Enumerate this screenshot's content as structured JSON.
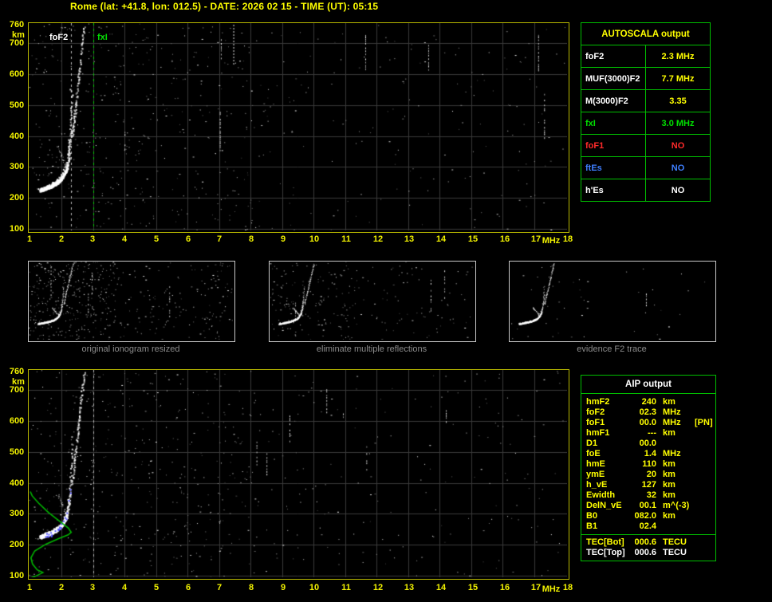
{
  "title": "Rome (lat: +41.8, lon: 012.5) - DATE: 2026 02 15 - TIME (UT): 05:15",
  "axes": {
    "x_ticks": [
      "1",
      "2",
      "3",
      "4",
      "5",
      "6",
      "7",
      "8",
      "9",
      "10",
      "11",
      "12",
      "13",
      "14",
      "15",
      "16",
      "17",
      "18"
    ],
    "x_unit": "MHz",
    "y_ticks": [
      "760",
      "700",
      "600",
      "500",
      "400",
      "300",
      "200",
      "100"
    ],
    "y_unit": "km"
  },
  "top_plot": {
    "fof2_label": "foF2",
    "fxi_label": "fxI",
    "fof2_mhz": 2.3,
    "fxi_mhz": 3.0
  },
  "autoscala_table": {
    "title": "AUTOSCALA output",
    "rows": [
      {
        "label": "foF2",
        "value": "2.3 MHz",
        "label_color": "#ffffff",
        "value_color": "#ffff00"
      },
      {
        "label": "MUF(3000)F2",
        "value": "7.7 MHz",
        "label_color": "#ffffff",
        "value_color": "#ffff00"
      },
      {
        "label": "M(3000)F2",
        "value": "3.35",
        "label_color": "#ffffff",
        "value_color": "#ffff00"
      },
      {
        "label": "fxI",
        "value": "3.0 MHz",
        "label_color": "#00e000",
        "value_color": "#00e000"
      },
      {
        "label": "foF1",
        "value": "NO",
        "label_color": "#ff2a2a",
        "value_color": "#ff2a2a"
      },
      {
        "label": "ftEs",
        "value": "NO",
        "label_color": "#3f7fff",
        "value_color": "#3f7fff"
      },
      {
        "label": "h'Es",
        "value": "NO",
        "label_color": "#ffffff",
        "value_color": "#ffffff"
      }
    ]
  },
  "thumbnails": [
    {
      "caption": "original ionogram resized"
    },
    {
      "caption": "eliminate multiple reflections"
    },
    {
      "caption": "evidence F2 trace"
    }
  ],
  "aip_table": {
    "title": "AIP output",
    "rows": [
      {
        "label": "hmF2",
        "value": "240",
        "unit": "km",
        "extra": ""
      },
      {
        "label": "foF2",
        "value": "02.3",
        "unit": "MHz",
        "extra": ""
      },
      {
        "label": "foF1",
        "value": "00.0",
        "unit": "MHz",
        "extra": "[PN]"
      },
      {
        "label": "hmF1",
        "value": "---",
        "unit": "km",
        "extra": ""
      },
      {
        "label": "D1",
        "value": "00.0",
        "unit": "",
        "extra": ""
      },
      {
        "label": "foE",
        "value": "1.4",
        "unit": "MHz",
        "extra": ""
      },
      {
        "label": "hmE",
        "value": "110",
        "unit": "km",
        "extra": ""
      },
      {
        "label": "ymE",
        "value": "20",
        "unit": "km",
        "extra": ""
      },
      {
        "label": "h_vE",
        "value": "127",
        "unit": "km",
        "extra": ""
      },
      {
        "label": "Ewidth",
        "value": "32",
        "unit": "km",
        "extra": ""
      },
      {
        "label": "DelN_vE",
        "value": "00.1",
        "unit": "m^(-3)",
        "extra": ""
      },
      {
        "label": "B0",
        "value": "082.0",
        "unit": "km",
        "extra": ""
      },
      {
        "label": "B1",
        "value": "02.4",
        "unit": "",
        "extra": ""
      }
    ],
    "tec_rows": [
      {
        "label": "TEC[Bot]",
        "value": "000.6",
        "unit": "TECU",
        "color": "#ffff00"
      },
      {
        "label": "TEC[Top]",
        "value": "000.6",
        "unit": "TECU",
        "color": "#ffffff"
      }
    ]
  },
  "profile": {
    "foF2": 2.3,
    "hmF2": 240,
    "foE": 1.4,
    "hmE": 110
  },
  "colors": {
    "background": "#000000",
    "title_text": "#ffff00",
    "axis_text": "#f2f200",
    "plot_border": "#b8b800",
    "grid": "#3a3a3a",
    "table_border": "#00be00",
    "table_title": "#ffff00",
    "aip_title": "#ffffff",
    "aip_text": "#ffff00",
    "caption_text": "#8c8c8c",
    "trace": "#ffffff",
    "profile": "#00b400",
    "scaled_points": "#5858ff",
    "fof2_marker": "#ffffff",
    "fxi_marker": "#00dd00",
    "thumb_border": "#c8c8c8"
  }
}
